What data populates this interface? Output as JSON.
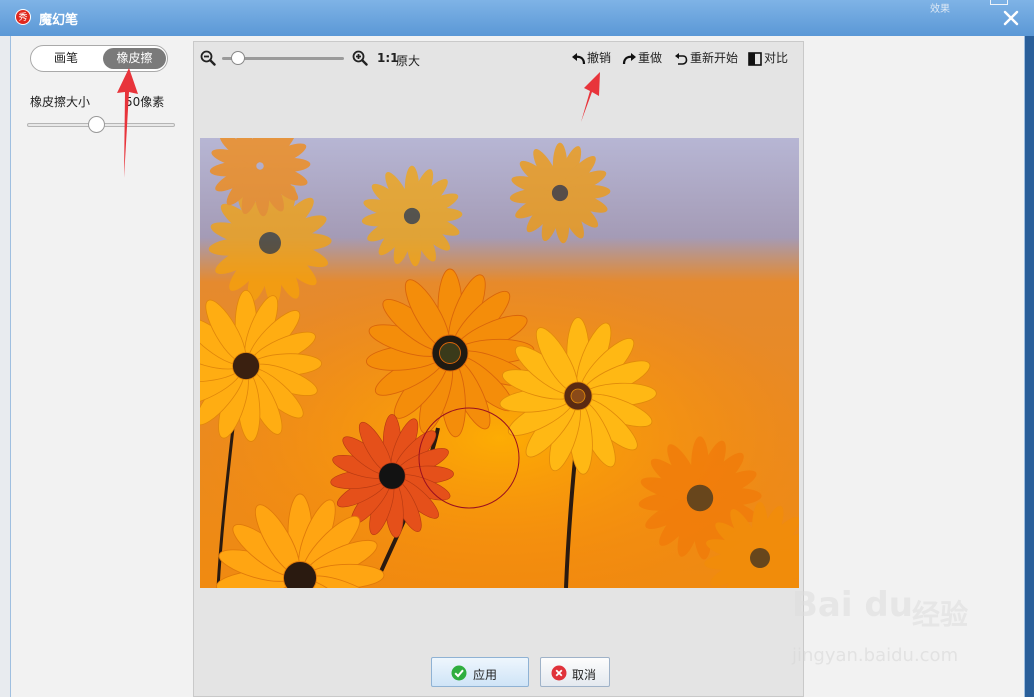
{
  "window": {
    "title": "魔幻笔",
    "logo_char": "秀",
    "close_icon": "close-icon",
    "background_text": "效果"
  },
  "left_panel": {
    "mode_pen": "画笔",
    "mode_eraser": "橡皮擦",
    "active_mode": "橡皮擦",
    "size_label": "橡皮擦大小",
    "size_value": "50像素",
    "size_level": 0.48
  },
  "toolbar": {
    "zoom_level": 0.1,
    "one_to_one": "1:1",
    "original_size": "原大",
    "undo": "撤销",
    "redo": "重做",
    "restart": "重新开始",
    "compare": "对比"
  },
  "footer": {
    "apply": "应用",
    "cancel": "取消"
  },
  "watermark": {
    "logo": "Bai du",
    "cn": "经验",
    "url": "jingyan.baidu.com"
  },
  "colors": {
    "titlebar": "#5b98d6",
    "accent_red": "#e8343b",
    "apply_check": "#2fae3f",
    "cancel_x": "#e0323a"
  }
}
